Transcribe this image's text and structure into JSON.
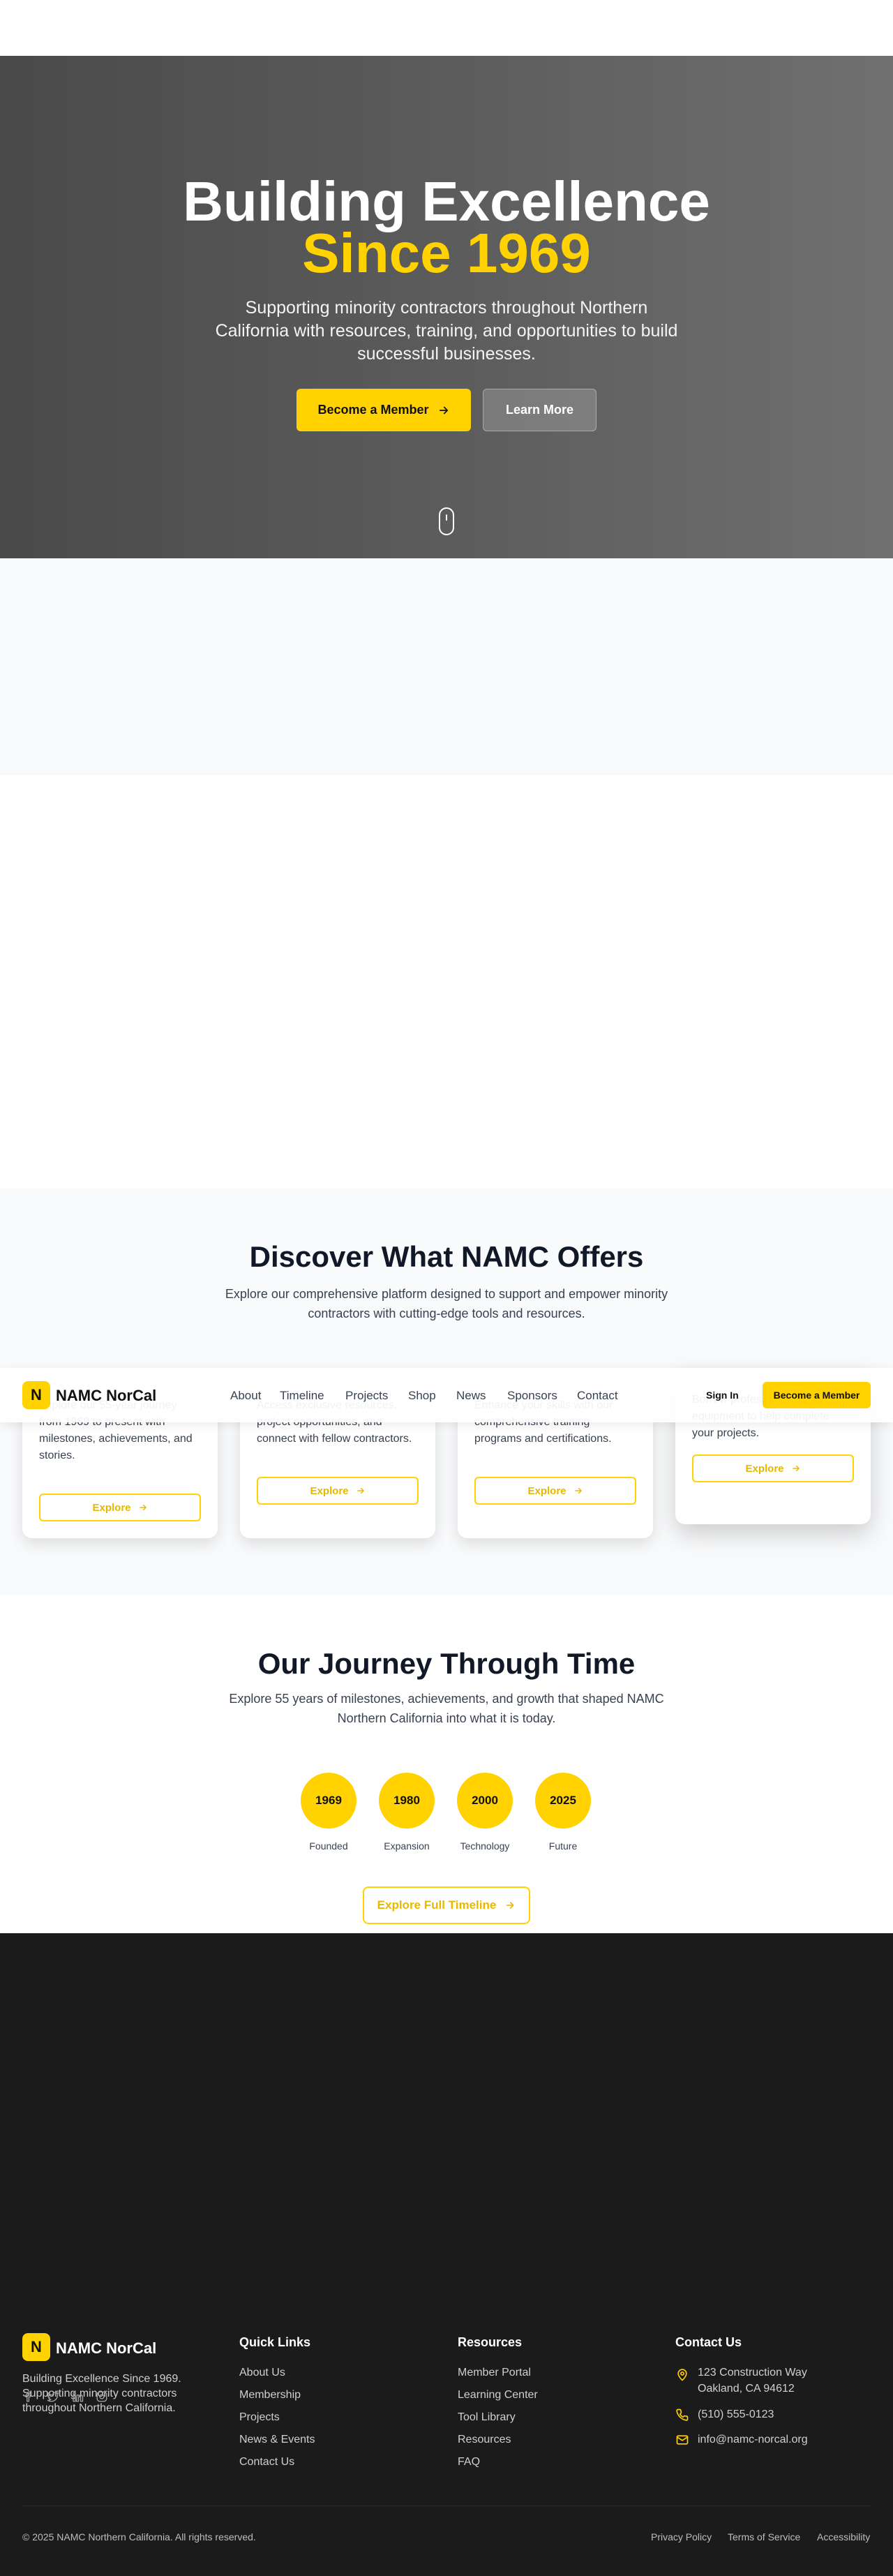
{
  "hero": {
    "title_line1": "Building Excellence",
    "title_line2": "Since 1969",
    "subtitle": "Supporting minority contractors throughout Northern California with resources, training, and opportunities to build successful businesses.",
    "primary_cta": "Become a Member",
    "secondary_cta": "Learn More"
  },
  "discover": {
    "title": "Discover What NAMC Offers",
    "subtitle": "Explore our comprehensive platform designed to support and empower minority contractors with cutting-edge tools and resources.",
    "cards": [
      {
        "desc": "Explore our 55-year journey from 1969 to present with milestones, achievements, and stories.",
        "button": "Explore"
      },
      {
        "desc": "Access exclusive resources, project opportunities, and connect with fellow contractors.",
        "button": "Explore"
      },
      {
        "desc": "Enhance your skills with our comprehensive training programs and certifications.",
        "button": "Explore"
      },
      {
        "desc": "Borrow professional tools and equipment to help complete your projects.",
        "button": "Explore"
      }
    ]
  },
  "navbar": {
    "logo_letter": "N",
    "brand": "NAMC NorCal",
    "links": [
      "About",
      "Timeline",
      "Projects",
      "Shop",
      "News",
      "Sponsors",
      "Contact"
    ],
    "sign_in": "Sign In",
    "cta": "Become a Member"
  },
  "timeline": {
    "title": "Our Journey Through Time",
    "subtitle": "Explore 55 years of milestones, achievements, and growth that shaped NAMC Northern California into what it is today.",
    "items": [
      {
        "year": "1969",
        "label": "Founded"
      },
      {
        "year": "1980",
        "label": "Expansion"
      },
      {
        "year": "2000",
        "label": "Technology"
      },
      {
        "year": "2025",
        "label": "Future"
      }
    ],
    "cta": "Explore Full Timeline"
  },
  "footer": {
    "logo_letter": "N",
    "brand": "NAMC NorCal",
    "tagline": "Building Excellence Since 1969. Supporting minority contractors throughout Northern California.",
    "quick_links_title": "Quick Links",
    "quick_links": [
      "About Us",
      "Membership",
      "Projects",
      "News & Events",
      "Contact Us"
    ],
    "resources_title": "Resources",
    "resources": [
      "Member Portal",
      "Learning Center",
      "Tool Library",
      "Resources",
      "FAQ"
    ],
    "contact_title": "Contact Us",
    "address_line1": "123 Construction Way",
    "address_line2": "Oakland, CA 94612",
    "phone": "(510) 555-0123",
    "email": "info@namc-norcal.org",
    "copyright": "© 2025 NAMC Northern California. All rights reserved.",
    "legal_links": [
      "Privacy Policy",
      "Terms of Service",
      "Accessibility"
    ]
  },
  "colors": {
    "accent": "#ffd200",
    "footer_bg": "#1b1b1b",
    "hero_bg": "#555555"
  },
  "icons": [
    "arrow-right-icon",
    "mouse-scroll-icon",
    "facebook-icon",
    "twitter-icon",
    "linkedin-icon",
    "instagram-icon",
    "map-pin-icon",
    "phone-icon",
    "mail-icon"
  ]
}
